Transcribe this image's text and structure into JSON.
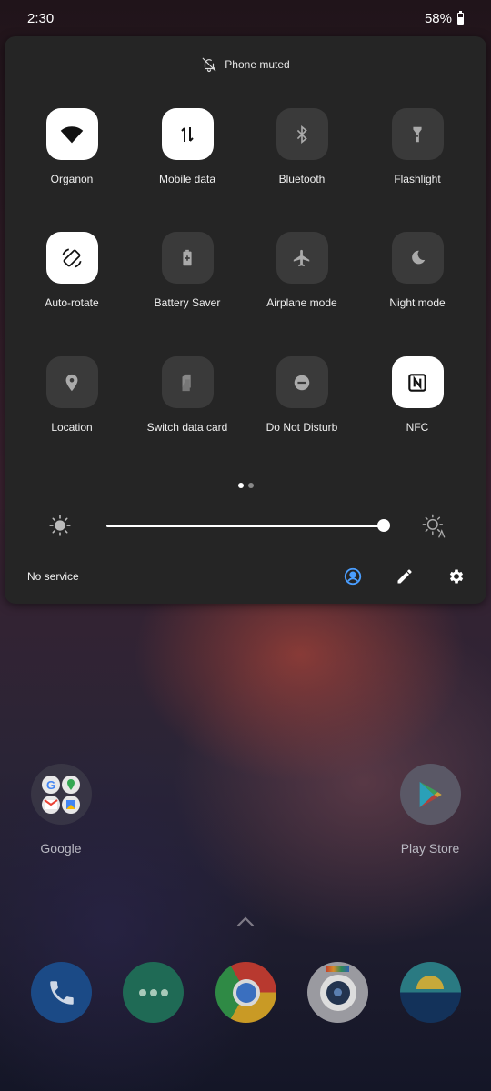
{
  "status_bar": {
    "time": "2:30",
    "battery": "58%"
  },
  "quick_settings": {
    "notice": "Phone muted",
    "tiles": [
      {
        "label": "Organon",
        "icon": "wifi-icon",
        "on": true
      },
      {
        "label": "Mobile data",
        "icon": "mobile-data-icon",
        "on": true
      },
      {
        "label": "Bluetooth",
        "icon": "bluetooth-icon",
        "on": false
      },
      {
        "label": "Flashlight",
        "icon": "flashlight-icon",
        "on": false
      },
      {
        "label": "Auto-rotate",
        "icon": "auto-rotate-icon",
        "on": true
      },
      {
        "label": "Battery Saver",
        "icon": "battery-saver-icon",
        "on": false
      },
      {
        "label": "Airplane mode",
        "icon": "airplane-icon",
        "on": false
      },
      {
        "label": "Night mode",
        "icon": "moon-icon",
        "on": false
      },
      {
        "label": "Location",
        "icon": "location-icon",
        "on": false
      },
      {
        "label": "Switch data card",
        "icon": "sim-card-icon",
        "on": false
      },
      {
        "label": "Do Not Disturb",
        "icon": "do-not-disturb-icon",
        "on": false
      },
      {
        "label": "NFC",
        "icon": "nfc-icon",
        "on": true
      }
    ],
    "page_count": 2,
    "active_page": 1,
    "brightness_level": 0.99,
    "footer": {
      "carrier_status": "No service"
    }
  },
  "home": {
    "apps": [
      {
        "name": "Google",
        "icon": "google-folder-icon"
      },
      {
        "name": "Play Store",
        "icon": "play-store-icon"
      }
    ],
    "dock": [
      "phone-icon",
      "messages-icon",
      "chrome-icon",
      "camera-icon",
      "gallery-icon"
    ]
  },
  "colors": {
    "panel": "#252525",
    "tile_off": "#3a3a3a",
    "tile_on": "#ffffff",
    "accent": "#4a9eff"
  }
}
